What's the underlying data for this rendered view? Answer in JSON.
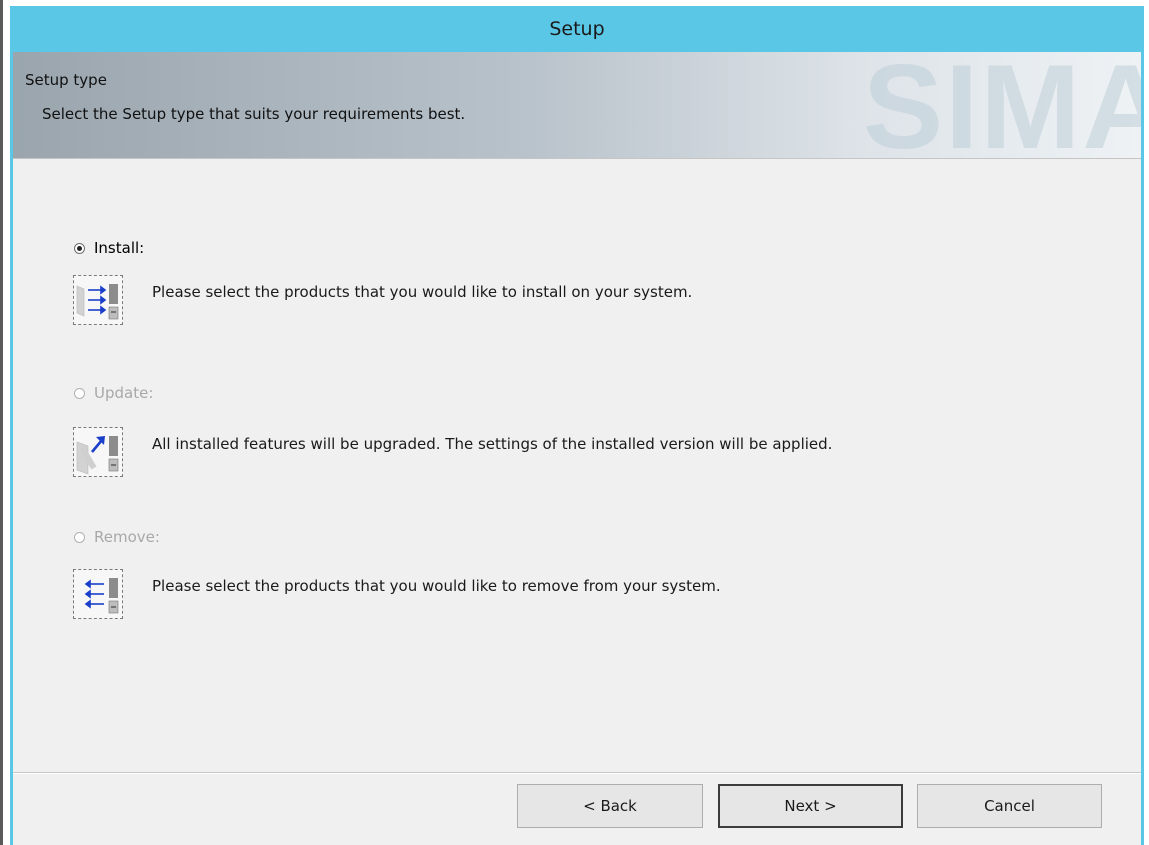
{
  "window": {
    "title": "Setup"
  },
  "banner": {
    "heading": "Setup type",
    "subheading": "Select the Setup type that suits your requirements best.",
    "watermark": "SIMA"
  },
  "options": [
    {
      "label": "Install:",
      "description": "Please select the products that you would like to install on your system.",
      "selected": true,
      "enabled": true,
      "icon": "install-icon"
    },
    {
      "label": "Update:",
      "description": "All installed features will be upgraded. The settings of the installed version will be applied.",
      "selected": false,
      "enabled": false,
      "icon": "update-icon"
    },
    {
      "label": "Remove:",
      "description": "Please select the products that you would like to remove from your system.",
      "selected": false,
      "enabled": false,
      "icon": "remove-icon"
    }
  ],
  "buttons": {
    "back": "< Back",
    "next": "Next >",
    "cancel": "Cancel"
  },
  "colors": {
    "titlebar": "#5bc7e6",
    "arrow": "#1a3fc9",
    "disabled_text": "#a8a8a8"
  }
}
